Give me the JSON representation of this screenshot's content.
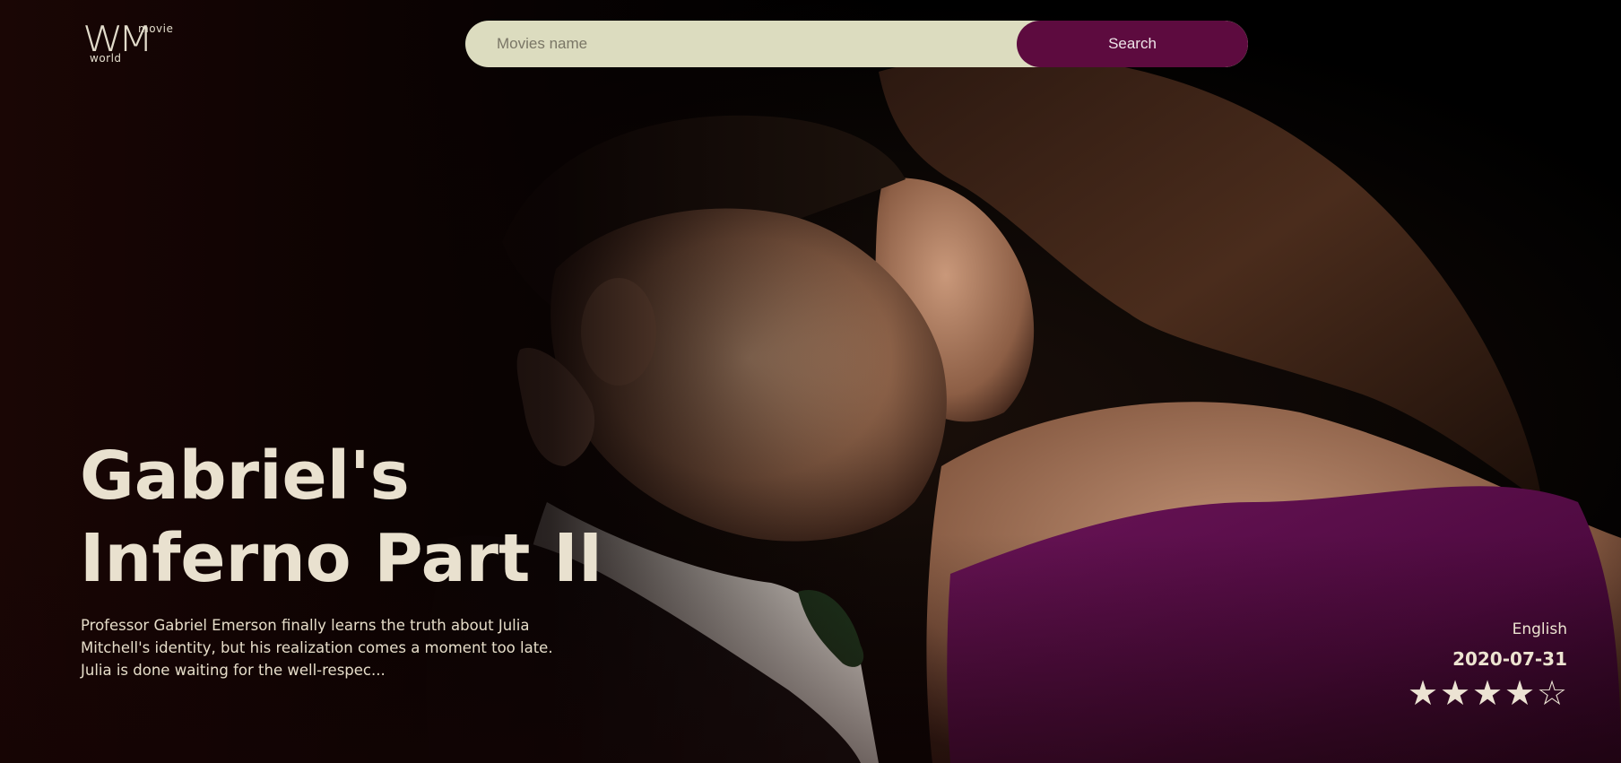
{
  "logo": {
    "letters": "WM",
    "top_word": "movie",
    "bottom_word": "world"
  },
  "search": {
    "placeholder": "Movies name",
    "value": "",
    "button_label": "Search"
  },
  "movie": {
    "title": "Gabriel's Inferno Part II",
    "description": "Professor Gabriel Emerson finally learns the truth about Julia Mitchell's identity, but his realization comes a moment too late. Julia is done waiting for the well-respec...",
    "language": "English",
    "release_date": "2020-07-31",
    "rating": {
      "value": 4,
      "max": 5,
      "filled_glyph": "★",
      "empty_glyph": "☆"
    }
  },
  "colors": {
    "search_bar_bg": "#dcdcbf",
    "search_button_bg": "#5d0b3f",
    "text_light": "#e9e1cf",
    "background_dark": "#0a0202",
    "dress_purple": "#5a0f4a"
  },
  "icons": {
    "star_filled": "star-filled-icon",
    "star_empty": "star-empty-icon"
  }
}
